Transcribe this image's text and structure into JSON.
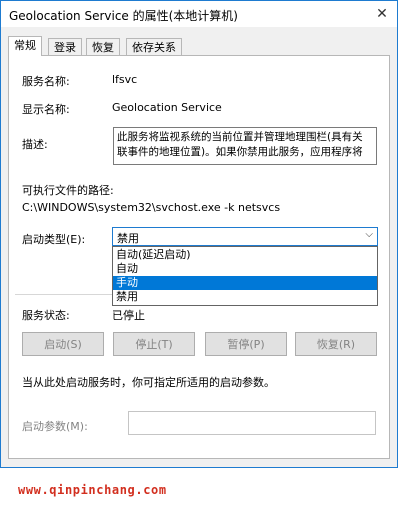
{
  "window": {
    "title": "Geolocation Service 的属性(本地计算机)"
  },
  "tabs": [
    {
      "label": "常规",
      "active": true
    },
    {
      "label": "登录"
    },
    {
      "label": "恢复"
    },
    {
      "label": "依存关系"
    }
  ],
  "general": {
    "service_name_label": "服务名称:",
    "service_name_value": "lfsvc",
    "display_name_label": "显示名称:",
    "display_name_value": "Geolocation Service",
    "description_label": "描述:",
    "description_line1": "此服务将监视系统的当前位置并管理地理围栏(具有关",
    "description_line2": "联事件的地理位置)。如果你禁用此服务，应用程序将",
    "exe_path_label": "可执行文件的路径:",
    "exe_path_value": "C:\\WINDOWS\\system32\\svchost.exe -k netsvcs",
    "startup_type_label": "启动类型(E):",
    "startup_type_value": "禁用",
    "startup_options": [
      "自动(延迟启动)",
      "自动",
      "手动",
      "禁用"
    ],
    "startup_highlighted": "手动",
    "service_status_label": "服务状态:",
    "service_status_value": "已停止",
    "buttons": {
      "start": "启动(S)",
      "stop": "停止(T)",
      "pause": "暂停(P)",
      "resume": "恢复(R)"
    },
    "hint_text": "当从此处启动服务时，你可指定所适用的启动参数。",
    "start_params_label": "启动参数(M):",
    "start_params_value": ""
  },
  "watermark": "www.qinpinchang.com",
  "colors": {
    "accent": "#0078d7",
    "watermark": "#d22f1f"
  }
}
